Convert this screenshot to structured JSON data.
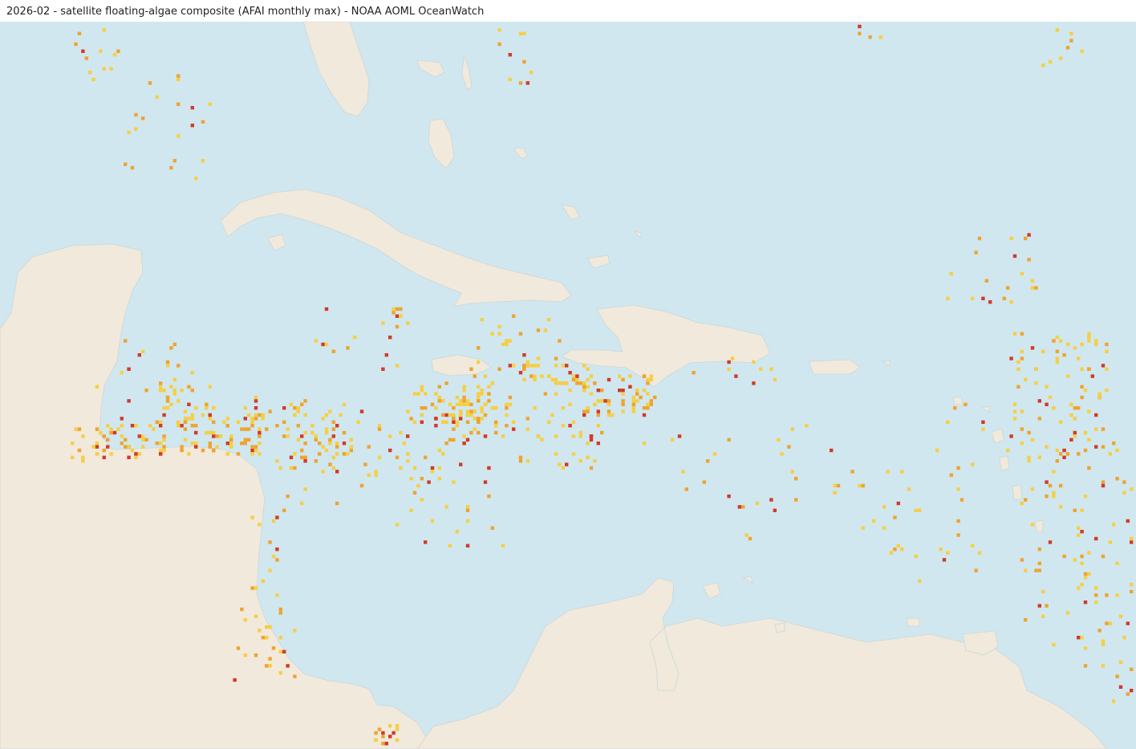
{
  "header": {
    "title": "2026-02 - satellite floating-algae composite (AFAI monthly max) - NOAA AOML OceanWatch"
  },
  "colors": {
    "ocean": "#d1e7ef",
    "land": "#f1e9db",
    "algae_low": "#f5cf45",
    "algae_mid": "#eea42f",
    "algae_high": "#d13a2a"
  },
  "map": {
    "region": "Caribbean Sea and western tropical Atlantic",
    "layer": "floating-algae density",
    "levels": [
      "low",
      "mid",
      "high"
    ]
  }
}
